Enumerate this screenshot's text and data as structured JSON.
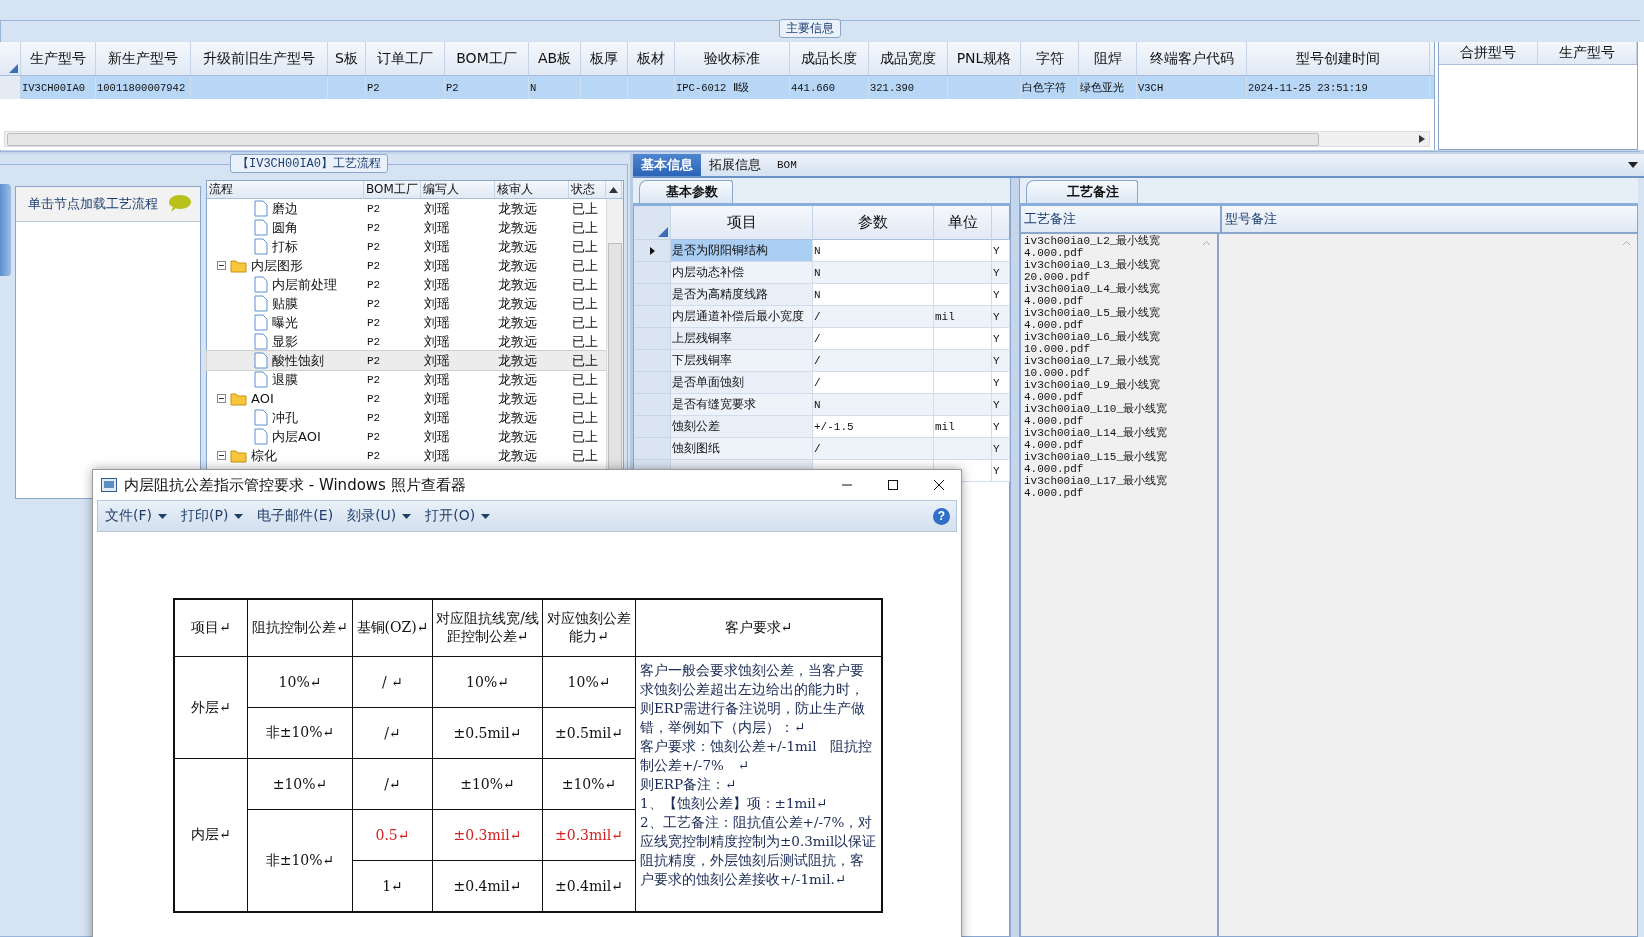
{
  "main_info": {
    "title": "主要信息",
    "columns": [
      "生产型号",
      "新生产型号",
      "升级前旧生产型号",
      "S板",
      "订单工厂",
      "BOM工厂",
      "AB板",
      "板厚",
      "板材",
      "验收标准",
      "成品长度",
      "成品宽度",
      "PNL规格",
      "字符",
      "阻焊",
      "终端客户代码",
      "型号创建时间"
    ],
    "rows": [
      {
        "selected": true,
        "cells": [
          "IV3CH00IA0",
          "10011800007942",
          null,
          null,
          "P2",
          "P2",
          "N",
          null,
          null,
          "IPC-6012 Ⅱ级",
          "441.660",
          "321.390",
          null,
          "白色字符",
          "绿色亚光",
          "V3CH",
          "2024-11-25 23:51:19"
        ]
      }
    ]
  },
  "merge_panel": {
    "columns": [
      "合拼型号",
      "生产型号"
    ]
  },
  "process": {
    "title": "【IV3CH00IA0】工艺流程",
    "hint": "单击节点加载工艺流程",
    "columns": [
      "流程",
      "BOM工厂",
      "编写人",
      "核审人",
      "状态"
    ],
    "tree": [
      {
        "kind": "group",
        "children": [
          {
            "kind": "step",
            "name": "磨边",
            "bom": "P2",
            "writer": "刘瑶",
            "reviewer": "龙敦远",
            "status": "已上",
            "selected": false
          },
          {
            "kind": "step",
            "name": "圆角",
            "bom": "P2",
            "writer": "刘瑶",
            "reviewer": "龙敦远",
            "status": "已上",
            "selected": false
          },
          {
            "kind": "step",
            "name": "打标",
            "bom": "P2",
            "writer": "刘瑶",
            "reviewer": "龙敦远",
            "status": "已上",
            "selected": false
          }
        ]
      },
      {
        "kind": "folder",
        "name": "内层图形",
        "bom": "P2",
        "writer": "刘瑶",
        "reviewer": "龙敦远",
        "status": "已上",
        "selected": false,
        "expanded": true,
        "children": [
          {
            "kind": "step",
            "name": "内层前处理",
            "bom": "P2",
            "writer": "刘瑶",
            "reviewer": "龙敦远",
            "status": "已上",
            "selected": false
          },
          {
            "kind": "step",
            "name": "贴膜",
            "bom": "P2",
            "writer": "刘瑶",
            "reviewer": "龙敦远",
            "status": "已上",
            "selected": false
          },
          {
            "kind": "step",
            "name": "曝光",
            "bom": "P2",
            "writer": "刘瑶",
            "reviewer": "龙敦远",
            "status": "已上",
            "selected": false
          },
          {
            "kind": "step",
            "name": "显影",
            "bom": "P2",
            "writer": "刘瑶",
            "reviewer": "龙敦远",
            "status": "已上",
            "selected": false
          },
          {
            "kind": "step",
            "name": "酸性蚀刻",
            "bom": "P2",
            "writer": "刘瑶",
            "reviewer": "龙敦远",
            "status": "已上",
            "selected": true
          },
          {
            "kind": "step",
            "name": "退膜",
            "bom": "P2",
            "writer": "刘瑶",
            "reviewer": "龙敦远",
            "status": "已上",
            "selected": false
          }
        ]
      },
      {
        "kind": "folder",
        "name": "AOI",
        "bom": "P2",
        "writer": "刘瑶",
        "reviewer": "龙敦远",
        "status": "已上",
        "selected": false,
        "expanded": true,
        "children": [
          {
            "kind": "step",
            "name": "冲孔",
            "bom": "P2",
            "writer": "刘瑶",
            "reviewer": "龙敦远",
            "status": "已上",
            "selected": false
          },
          {
            "kind": "step",
            "name": "内层AOI",
            "bom": "P2",
            "writer": "刘瑶",
            "reviewer": "龙敦远",
            "status": "已上",
            "selected": false
          }
        ]
      },
      {
        "kind": "folder",
        "name": "棕化",
        "bom": "P2",
        "writer": "刘瑶",
        "reviewer": "龙敦远",
        "status": "已上",
        "selected": false,
        "expanded": true
      }
    ]
  },
  "detail_tabs": [
    {
      "label": "基本信息",
      "selected": true
    },
    {
      "label": "拓展信息",
      "selected": false
    },
    {
      "label": "BOM",
      "selected": false
    }
  ],
  "params": {
    "tab": "基本参数",
    "columns": [
      "项目",
      "参数",
      "单位"
    ],
    "rows": [
      {
        "item": "是否为阴阳铜结构",
        "value": "N",
        "flag": "Y",
        "selected": true
      },
      {
        "item": "内层动态补偿",
        "value": "N",
        "flag": "Y",
        "selected": false
      },
      {
        "item": "是否为高精度线路",
        "value": "N",
        "flag": "Y",
        "selected": false
      },
      {
        "item": "内层通道补偿后最小宽度",
        "value": "/",
        "unit": "mil",
        "flag": "Y",
        "selected": false
      },
      {
        "item": "上层残铜率",
        "value": "/",
        "flag": "Y",
        "selected": false
      },
      {
        "item": "下层残铜率",
        "value": "/",
        "flag": "Y",
        "selected": false
      },
      {
        "item": "是否单面蚀刻",
        "value": "/",
        "flag": "Y",
        "selected": false
      },
      {
        "item": "是否有缝宽要求",
        "value": "N",
        "flag": "Y",
        "selected": false
      },
      {
        "item": "蚀刻公差",
        "value": "+/-1.5",
        "unit": "mil",
        "flag": "Y",
        "selected": false
      },
      {
        "item": "蚀刻图纸",
        "value": "/",
        "flag": "Y",
        "selected": false
      },
      {
        "flag": "Y",
        "selected": false
      }
    ]
  },
  "notes": {
    "tab": "工艺备注",
    "columns": [
      "工艺备注",
      "型号备注"
    ],
    "lines": [
      "iv3ch00ia0_L2_最小线宽",
      "4.000.pdf",
      "iv3ch00ia0_L3_最小线宽",
      "20.000.pdf",
      "iv3ch00ia0_L4_最小线宽",
      "4.000.pdf",
      "iv3ch00ia0_L5_最小线宽",
      "4.000.pdf",
      "iv3ch00ia0_L6_最小线宽",
      "10.000.pdf",
      "iv3ch00ia0_L7_最小线宽",
      "10.000.pdf",
      "iv3ch00ia0_L9_最小线宽",
      "4.000.pdf",
      "iv3ch00ia0_L10_最小线宽",
      "4.000.pdf",
      "iv3ch00ia0_L14_最小线宽",
      "4.000.pdf",
      "iv3ch00ia0_L15_最小线宽",
      "4.000.pdf",
      "iv3ch00ia0_L17_最小线宽",
      "4.000.pdf"
    ]
  },
  "viewer": {
    "title": "内层阻抗公差指示管控要求 - Windows 照片查看器",
    "menu": [
      {
        "label": "文件(F)",
        "dropdown": true
      },
      {
        "label": "打印(P)",
        "dropdown": true
      },
      {
        "label": "电子邮件(E)",
        "dropdown": false
      },
      {
        "label": "刻录(U)",
        "dropdown": true
      },
      {
        "label": "打开(O)",
        "dropdown": true
      }
    ],
    "help": "?",
    "document": {
      "header": [
        "项目↵",
        "阻抗控制公差↵",
        "基铜(OZ)↵",
        "对应阻抗线宽/线距控制公差↵",
        "对应蚀刻公差能力↵",
        "客户要求↵"
      ],
      "layers": [
        {
          "label": "外层↵",
          "tolerances": [
            {
              "label": "10%↵",
              "rows": [
                {
                  "copper": "/ ↵",
                  "line": "10%↵",
                  "etch": "10%↵"
                }
              ]
            },
            {
              "label": "非±10%↵",
              "rows": [
                {
                  "copper": "/↵",
                  "line": "±0.5mil↵",
                  "etch": "±0.5mil↵"
                }
              ]
            }
          ]
        },
        {
          "label": "内层↵",
          "tolerances": [
            {
              "label": "±10%↵",
              "rows": [
                {
                  "copper": "/↵",
                  "line": "±10%↵",
                  "etch": "±10%↵"
                }
              ]
            },
            {
              "label": "非±10%↵",
              "rows": [
                {
                  "copper": "0.5↵",
                  "line": "±0.3mil↵",
                  "etch": "±0.3mil↵",
                  "color": "#d42020"
                },
                {
                  "copper": "1↵",
                  "line": "±0.4mil↵",
                  "etch": "±0.4mil↵"
                }
              ]
            }
          ]
        }
      ],
      "remark": [
        "客户一般会要求蚀刻公差，当客户要求蚀刻公差超出左边给出的能力时，则ERP需进行备注说明，防止生产做错，举例如下（内层）：↵",
        "客户要求：蚀刻公差+/-1mil　阻抗控制公差+/-7%　↵",
        "则ERP备注：↵",
        "1、【蚀刻公差】项：±1mil↵",
        "2、工艺备注：阻抗值公差+/-7%，对应线宽控制精度控制为±0.3mil以保证阻抗精度，外层蚀刻后测试阻抗，客户要求的蚀刻公差接收+/-1mil.↵"
      ]
    }
  }
}
